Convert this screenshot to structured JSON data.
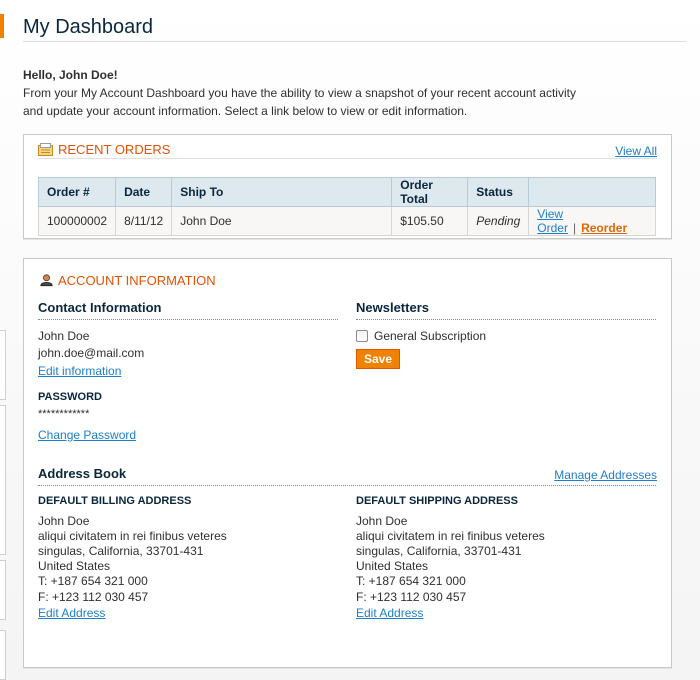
{
  "page": {
    "title": "My Dashboard"
  },
  "welcome": {
    "greeting": "Hello, John Doe!",
    "text": "From your My Account Dashboard you have the ability to view a snapshot of your recent account activity and update your account information. Select a link below to view or edit information."
  },
  "recent_orders": {
    "title": "Recent Orders",
    "view_all": "View All",
    "columns": [
      "Order #",
      "Date",
      "Ship To",
      "Order Total",
      "Status",
      ""
    ],
    "rows": [
      {
        "order": "100000002",
        "date": "8/11/12",
        "ship_to": "John Doe",
        "total": "$105.50",
        "status": "Pending",
        "view_label": "View Order",
        "separator": "|",
        "reorder_label": "Reorder"
      }
    ]
  },
  "account": {
    "title": "Account Information",
    "contact": {
      "title": "Contact Information",
      "name": "John Doe",
      "email": "john.doe@mail.com",
      "edit_label": "Edit information",
      "password_title": "Password",
      "password_mask": "************",
      "change_password_label": "Change Password"
    },
    "newsletters": {
      "title": "Newsletters",
      "subscription_label": "General Subscription",
      "save_label": "Save"
    },
    "address_book": {
      "title": "Address Book",
      "manage_label": "Manage Addresses",
      "billing": {
        "title": "Default Billing Address",
        "name": "John Doe",
        "street": "aliqui civitatem in rei finibus veteres",
        "city_line": "singulas, California, 33701-431",
        "country": "United States",
        "phone": "T: +187 654 321 000",
        "fax": "F: +123 112 030 457",
        "edit_label": "Edit Address"
      },
      "shipping": {
        "title": "Default Shipping Address",
        "name": "John Doe",
        "street": "aliqui civitatem in rei finibus veteres",
        "city_line": "singulas, California, 33701-431",
        "country": "United States",
        "phone": "T: +187 654 321 000",
        "fax": "F: +123 112 030 457",
        "edit_label": "Edit Address"
      }
    }
  },
  "colors": {
    "accent": "#e25203",
    "link": "#1e7ec8",
    "button": "#f18200",
    "header_bg": "#dde8ef"
  }
}
